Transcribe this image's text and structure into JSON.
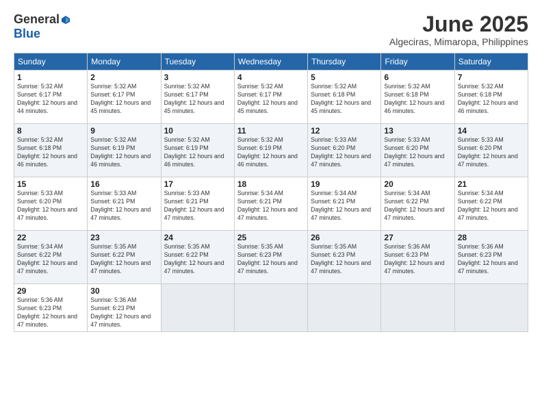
{
  "logo": {
    "general": "General",
    "blue": "Blue"
  },
  "title": "June 2025",
  "location": "Algeciras, Mimaropa, Philippines",
  "days_of_week": [
    "Sunday",
    "Monday",
    "Tuesday",
    "Wednesday",
    "Thursday",
    "Friday",
    "Saturday"
  ],
  "weeks": [
    [
      {
        "day": "1",
        "sunrise": "5:32 AM",
        "sunset": "6:17 PM",
        "daylight": "12 hours and 44 minutes."
      },
      {
        "day": "2",
        "sunrise": "5:32 AM",
        "sunset": "6:17 PM",
        "daylight": "12 hours and 45 minutes."
      },
      {
        "day": "3",
        "sunrise": "5:32 AM",
        "sunset": "6:17 PM",
        "daylight": "12 hours and 45 minutes."
      },
      {
        "day": "4",
        "sunrise": "5:32 AM",
        "sunset": "6:17 PM",
        "daylight": "12 hours and 45 minutes."
      },
      {
        "day": "5",
        "sunrise": "5:32 AM",
        "sunset": "6:18 PM",
        "daylight": "12 hours and 45 minutes."
      },
      {
        "day": "6",
        "sunrise": "5:32 AM",
        "sunset": "6:18 PM",
        "daylight": "12 hours and 46 minutes."
      },
      {
        "day": "7",
        "sunrise": "5:32 AM",
        "sunset": "6:18 PM",
        "daylight": "12 hours and 46 minutes."
      }
    ],
    [
      {
        "day": "8",
        "sunrise": "5:32 AM",
        "sunset": "6:18 PM",
        "daylight": "12 hours and 46 minutes."
      },
      {
        "day": "9",
        "sunrise": "5:32 AM",
        "sunset": "6:19 PM",
        "daylight": "12 hours and 46 minutes."
      },
      {
        "day": "10",
        "sunrise": "5:32 AM",
        "sunset": "6:19 PM",
        "daylight": "12 hours and 46 minutes."
      },
      {
        "day": "11",
        "sunrise": "5:32 AM",
        "sunset": "6:19 PM",
        "daylight": "12 hours and 46 minutes."
      },
      {
        "day": "12",
        "sunrise": "5:33 AM",
        "sunset": "6:20 PM",
        "daylight": "12 hours and 47 minutes."
      },
      {
        "day": "13",
        "sunrise": "5:33 AM",
        "sunset": "6:20 PM",
        "daylight": "12 hours and 47 minutes."
      },
      {
        "day": "14",
        "sunrise": "5:33 AM",
        "sunset": "6:20 PM",
        "daylight": "12 hours and 47 minutes."
      }
    ],
    [
      {
        "day": "15",
        "sunrise": "5:33 AM",
        "sunset": "6:20 PM",
        "daylight": "12 hours and 47 minutes."
      },
      {
        "day": "16",
        "sunrise": "5:33 AM",
        "sunset": "6:21 PM",
        "daylight": "12 hours and 47 minutes."
      },
      {
        "day": "17",
        "sunrise": "5:33 AM",
        "sunset": "6:21 PM",
        "daylight": "12 hours and 47 minutes."
      },
      {
        "day": "18",
        "sunrise": "5:34 AM",
        "sunset": "6:21 PM",
        "daylight": "12 hours and 47 minutes."
      },
      {
        "day": "19",
        "sunrise": "5:34 AM",
        "sunset": "6:21 PM",
        "daylight": "12 hours and 47 minutes."
      },
      {
        "day": "20",
        "sunrise": "5:34 AM",
        "sunset": "6:22 PM",
        "daylight": "12 hours and 47 minutes."
      },
      {
        "day": "21",
        "sunrise": "5:34 AM",
        "sunset": "6:22 PM",
        "daylight": "12 hours and 47 minutes."
      }
    ],
    [
      {
        "day": "22",
        "sunrise": "5:34 AM",
        "sunset": "6:22 PM",
        "daylight": "12 hours and 47 minutes."
      },
      {
        "day": "23",
        "sunrise": "5:35 AM",
        "sunset": "6:22 PM",
        "daylight": "12 hours and 47 minutes."
      },
      {
        "day": "24",
        "sunrise": "5:35 AM",
        "sunset": "6:22 PM",
        "daylight": "12 hours and 47 minutes."
      },
      {
        "day": "25",
        "sunrise": "5:35 AM",
        "sunset": "6:23 PM",
        "daylight": "12 hours and 47 minutes."
      },
      {
        "day": "26",
        "sunrise": "5:35 AM",
        "sunset": "6:23 PM",
        "daylight": "12 hours and 47 minutes."
      },
      {
        "day": "27",
        "sunrise": "5:36 AM",
        "sunset": "6:23 PM",
        "daylight": "12 hours and 47 minutes."
      },
      {
        "day": "28",
        "sunrise": "5:36 AM",
        "sunset": "6:23 PM",
        "daylight": "12 hours and 47 minutes."
      }
    ],
    [
      {
        "day": "29",
        "sunrise": "5:36 AM",
        "sunset": "6:23 PM",
        "daylight": "12 hours and 47 minutes."
      },
      {
        "day": "30",
        "sunrise": "5:36 AM",
        "sunset": "6:23 PM",
        "daylight": "12 hours and 47 minutes."
      },
      null,
      null,
      null,
      null,
      null
    ]
  ]
}
